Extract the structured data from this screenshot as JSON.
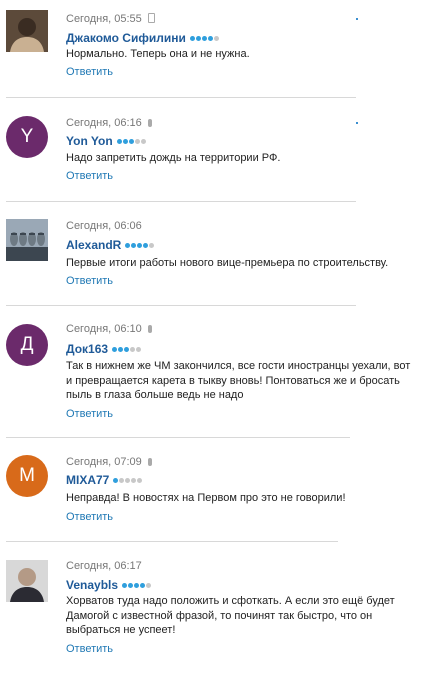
{
  "comments": [
    {
      "time": "Сегодня, 05:55",
      "device": "phone",
      "author": "Джакомо Сифилини",
      "rating": 4,
      "text": "Нормально. Теперь она и не нужна.",
      "reply": "Ответить",
      "avatar": {
        "kind": "photo",
        "icon": "user-photo-avatar",
        "colors": [
          "#5c4a3a",
          "#c9b092",
          "#3a2c22"
        ]
      }
    },
    {
      "time": "Сегодня, 06:16",
      "device": "mic",
      "author": "Yon Yon",
      "rating": 3,
      "text": "Надо запретить дождь на территории РФ.",
      "reply": "Ответить",
      "avatar": {
        "kind": "letter",
        "letter": "Y",
        "color": "#6b2a6b"
      }
    },
    {
      "time": "Сегодня, 06:06",
      "device": "",
      "author": "AlexandR",
      "rating": 4,
      "text": "Первые итоги работы нового вице-премьера по строительству.",
      "reply": "Ответить",
      "avatar": {
        "kind": "photo",
        "icon": "mount-rushmore-avatar",
        "colors": [
          "#9aa8b6",
          "#6e7a84",
          "#3c4650"
        ]
      }
    },
    {
      "time": "Сегодня, 06:10",
      "device": "mic",
      "author": "Док163",
      "rating": 3,
      "text": "Так в нижнем же ЧМ закончился, все гости иностранцы уехали, вот и превращается карета в тыкву вновь! Понтоваться же и бросать пыль в глаза больше ведь не надо",
      "reply": "Ответить",
      "avatar": {
        "kind": "letter",
        "letter": "Д",
        "color": "#6b2a6b"
      }
    },
    {
      "time": "Сегодня, 07:09",
      "device": "mic",
      "author": "MIXA77",
      "rating": 1,
      "text": "Неправда! В новостях на Первом про это не говорили!",
      "reply": "Ответить",
      "avatar": {
        "kind": "letter",
        "letter": "М",
        "color": "#d86a1a"
      }
    },
    {
      "time": "Сегодня, 06:17",
      "device": "",
      "author": "Venaybls",
      "rating": 4,
      "text": "Хорватов туда надо положить и сфоткать. А если это ещё будет Дамогой с известной фразой, то починят так быстро, что он выбраться не успеет!",
      "reply": "Ответить",
      "avatar": {
        "kind": "photo",
        "icon": "user-photo-avatar",
        "colors": [
          "#d8d8d8",
          "#2b2b33",
          "#b49a86"
        ]
      }
    }
  ],
  "colors": {
    "author": "#1f5a98",
    "reply": "#1f78b4",
    "rating_on": "#2f9fdd",
    "rating_off": "#c8c8c8"
  }
}
